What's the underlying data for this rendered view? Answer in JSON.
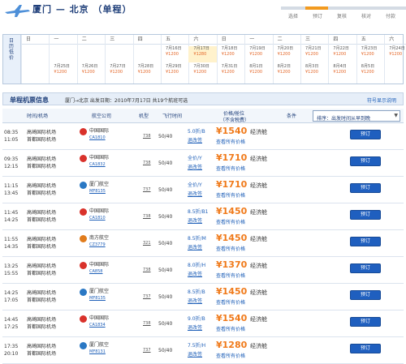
{
  "header": {
    "title": "厦门 — 北京  （单程）",
    "steps": [
      "选择",
      "预订",
      "复核",
      "核对",
      "付款"
    ]
  },
  "date_strip": {
    "side_label": "日历低价",
    "weekdays": [
      "日",
      "一",
      "二",
      "三",
      "四",
      "五",
      "六",
      "日",
      "一",
      "二",
      "三",
      "四",
      "五",
      "六"
    ],
    "cells": [
      {
        "date": "7月25日",
        "price": "¥1200"
      },
      {
        "date": "7月26日",
        "price": "¥1200"
      },
      {
        "date": "7月27日",
        "price": "¥1200"
      },
      {
        "date": "7月28日",
        "price": "¥1200"
      },
      {
        "date": "7月29日",
        "price": "¥1200"
      },
      {
        "date": "7月16日",
        "price": "¥1200",
        "row": 0
      },
      {
        "date": "7月17日",
        "price": "¥1280",
        "row": 0
      },
      {
        "date": "7月30日",
        "price": "¥1200"
      },
      {
        "date": "7月31日",
        "price": "¥1200"
      },
      {
        "date": "8月1日",
        "price": "¥1200"
      },
      {
        "date": "8月2日",
        "price": "¥1200"
      },
      {
        "date": "8月3日",
        "price": "¥1200"
      },
      {
        "date": "8月4日",
        "price": "¥1200"
      },
      {
        "date": "8月5日",
        "price": "¥1200"
      }
    ],
    "top_cells": [
      {
        "date": "7月16日",
        "price": "¥1200"
      },
      {
        "date": "7月17日",
        "price": "¥1280"
      },
      {
        "date": "7月18日",
        "price": "¥1200"
      },
      {
        "date": "7月19日",
        "price": "¥1200"
      },
      {
        "date": "7月20日",
        "price": "¥1200"
      },
      {
        "date": "7月21日",
        "price": "¥1200"
      },
      {
        "date": "7月22日",
        "price": "¥1200"
      },
      {
        "date": "7月23日",
        "price": "¥1200"
      },
      {
        "date": "7月24日",
        "price": "¥1200"
      }
    ],
    "bottom_cells": [
      {
        "date": "7月25日",
        "price": "¥1200"
      },
      {
        "date": "7月26日",
        "price": "¥1200"
      },
      {
        "date": "7月27日",
        "price": "¥1200"
      },
      {
        "date": "7月28日",
        "price": "¥1200"
      },
      {
        "date": "7月29日",
        "price": "¥1200"
      },
      {
        "date": "7月30日",
        "price": "¥1200"
      },
      {
        "date": "7月31日",
        "price": "¥1200"
      },
      {
        "date": "8月1日",
        "price": "¥1200"
      },
      {
        "date": "8月2日",
        "price": "¥1200"
      },
      {
        "date": "8月3日",
        "price": "¥1200"
      },
      {
        "date": "8月4日",
        "price": "¥1200"
      },
      {
        "date": "8月5日",
        "price": "¥1200"
      }
    ]
  },
  "section": {
    "title": "单程机票信息",
    "subtitle": "厦门→北京  出发日期：2010年7月17日  共19个航班可选",
    "link": "符号显示说明"
  },
  "columns": {
    "time": "时间/机场",
    "airline": "航空公司",
    "aircraft": "机型",
    "duration": "飞行时间",
    "price": "价格/舱位",
    "price_sub": "（不含税费）",
    "conditions": "条件",
    "sort": "排序：出发时间从早到晚"
  },
  "flights": [
    {
      "dep": "08:35",
      "arr": "11:05",
      "from": "高崎国际机场",
      "to": "首都国际机场",
      "airline": "中国国际",
      "color": "#d9322b",
      "no": "CA1810",
      "ac": "738",
      "dur": "50/40",
      "disc": "5.0折/B",
      "price": "¥1540",
      "cabin": "经济舱",
      "ret": "退改签",
      "all": "查看所有价格"
    },
    {
      "dep": "09:35",
      "arr": "12:15",
      "from": "高崎国际机场",
      "to": "首都国际机场",
      "airline": "中国国际",
      "color": "#d9322b",
      "no": "CA1832",
      "ac": "738",
      "dur": "50/40",
      "disc": "全价/Y",
      "price": "¥1710",
      "cabin": "经济舱",
      "ret": "退改签",
      "all": "查看所有价格"
    },
    {
      "dep": "11:15",
      "arr": "13:45",
      "from": "高崎国际机场",
      "to": "首都国际机场",
      "airline": "厦门航空",
      "color": "#2a78c4",
      "no": "MF8135",
      "ac": "737",
      "dur": "50/40",
      "disc": "全价/Y",
      "price": "¥1710",
      "cabin": "经济舱",
      "ret": "退改签",
      "all": "查看所有价格"
    },
    {
      "dep": "11:45",
      "arr": "14:25",
      "from": "高崎国际机场",
      "to": "首都国际机场",
      "airline": "中国国际",
      "color": "#d9322b",
      "no": "CA1810",
      "ac": "738",
      "dur": "50/40",
      "disc": "8.5折/B1",
      "price": "¥1450",
      "cabin": "经济舱",
      "ret": "退改签",
      "all": "查看所有价格"
    },
    {
      "dep": "11:55",
      "arr": "14:35",
      "from": "高崎国际机场",
      "to": "首都国际机场",
      "airline": "南方航空",
      "color": "#e17c1c",
      "no": "CZ3779",
      "ac": "321",
      "dur": "50/40",
      "disc": "8.5折/M",
      "price": "¥1450",
      "cabin": "经济舱",
      "ret": "退改签",
      "all": "查看所有价格"
    },
    {
      "dep": "13:25",
      "arr": "15:55",
      "from": "高崎国际机场",
      "to": "首都国际机场",
      "airline": "中国国际",
      "color": "#d9322b",
      "no": "CA858",
      "ac": "738",
      "dur": "50/40",
      "disc": "8.0折/H",
      "price": "¥1370",
      "cabin": "经济舱",
      "ret": "退改签",
      "all": "查看所有价格"
    },
    {
      "dep": "14:25",
      "arr": "17:05",
      "from": "高崎国际机场",
      "to": "首都国际机场",
      "airline": "厦门航空",
      "color": "#2a78c4",
      "no": "MF8135",
      "ac": "737",
      "dur": "50/40",
      "disc": "8.5折/B",
      "price": "¥1450",
      "cabin": "经济舱",
      "ret": "退改签",
      "all": "查看所有价格"
    },
    {
      "dep": "14:45",
      "arr": "17:25",
      "from": "高崎国际机场",
      "to": "首都国际机场",
      "airline": "中国国际",
      "color": "#d9322b",
      "no": "CA1834",
      "ac": "738",
      "dur": "50/40",
      "disc": "9.0折/B",
      "price": "¥1540",
      "cabin": "经济舱",
      "ret": "退改签",
      "all": "查看所有价格"
    },
    {
      "dep": "17:35",
      "arr": "20:10",
      "from": "高崎国际机场",
      "to": "首都国际机场",
      "airline": "厦门航空",
      "color": "#2a78c4",
      "no": "MF8131",
      "ac": "737",
      "dur": "50/40",
      "disc": "7.5折/H",
      "price": "¥1280",
      "cabin": "经济舱",
      "ret": "退改签",
      "all": "查看所有价格"
    }
  ],
  "book_label": "预订"
}
